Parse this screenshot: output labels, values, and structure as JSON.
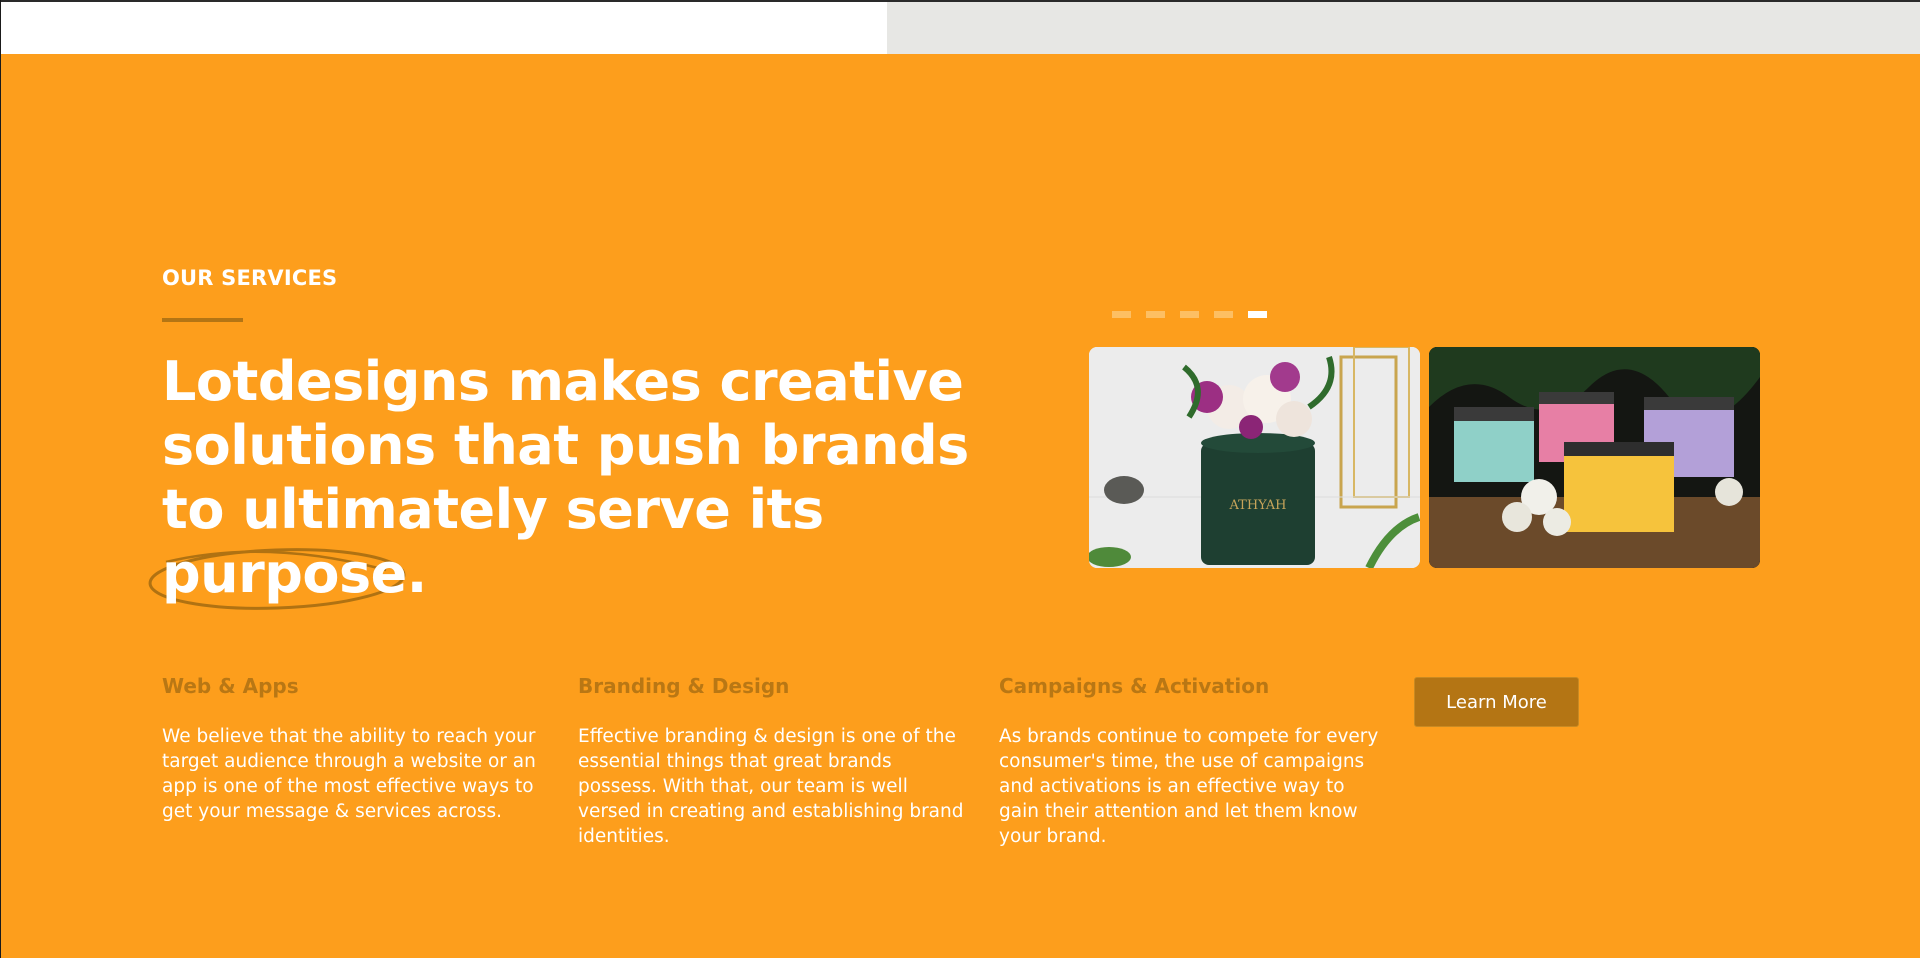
{
  "section": {
    "eyebrow": "OUR SERVICES",
    "headline_part1": "Lotdesigns makes creative solutions that push brands to ultimately serve its ",
    "headline_highlight": "purpose."
  },
  "carousel": {
    "slide_count": 5,
    "active_index": 4,
    "cards": [
      {
        "brand_text": "ATHYAH"
      },
      {
        "brand_text": ""
      }
    ]
  },
  "services": [
    {
      "title": "Web & Apps",
      "description": "We believe that the ability to reach your target audience through a website or an app is one of the most effective ways to get your message & services across."
    },
    {
      "title": "Branding & Design",
      "description": "Effective branding & design is one of the essential things that great brands possess. With that, our team is well versed in creating and establishing brand identities."
    },
    {
      "title": "Campaigns & Activation",
      "description": "As brands continue to compete for every consumer's time, the use of campaigns and activations is an effective way to gain their attention and let them know your brand."
    }
  ],
  "cta": {
    "label": "Learn More"
  },
  "colors": {
    "background": "#fd9e1c",
    "accent": "#b47514",
    "text": "#ffffff"
  }
}
